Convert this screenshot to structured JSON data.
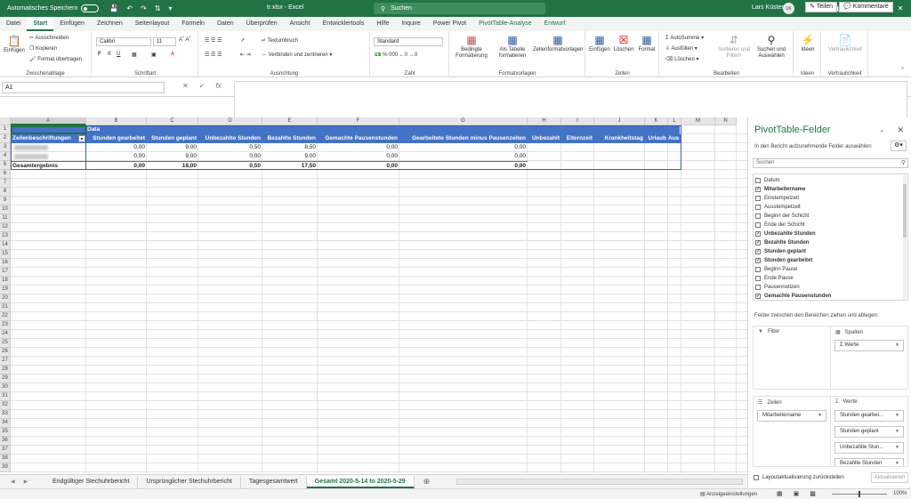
{
  "titlebar": {
    "autosave_label": "Automatisches Speichern",
    "filename": "tr.xlsx  -  Excel",
    "search_placeholder": "Suchen",
    "user_name": "Lars Küster",
    "user_initials": "LK"
  },
  "tabs": [
    "Datei",
    "Start",
    "Einfügen",
    "Zeichnen",
    "Seitenlayout",
    "Formeln",
    "Daten",
    "Überprüfen",
    "Ansicht",
    "Entwicklertools",
    "Hilfe",
    "Inquire",
    "Power Pivot",
    "PivotTable-Analyse",
    "Entwurf"
  ],
  "active_tab": "Start",
  "share_label": "Teilen",
  "comments_label": "Kommentare",
  "ribbon": {
    "clipboard": {
      "paste": "Einfügen",
      "cut": "Ausschneiden",
      "copy": "Kopieren",
      "format_painter": "Format übertragen",
      "group": "Zwischenablage"
    },
    "font": {
      "name": "Calibri",
      "size": "11",
      "group": "Schriftart"
    },
    "alignment": {
      "wrap": "Textumbruch",
      "merge": "Verbinden und zentrieren",
      "group": "Ausrichtung"
    },
    "number": {
      "format": "Standard",
      "group": "Zahl"
    },
    "styles": {
      "conditional": "Bedingte Formatierung",
      "as_table": "Als Tabelle formatieren",
      "cell_styles": "Zellenformatvorlagen",
      "group": "Formatvorlagen"
    },
    "cells": {
      "insert": "Einfügen",
      "delete": "Löschen",
      "format": "Format",
      "group": "Zellen"
    },
    "editing": {
      "autosum": "AutoSumme",
      "fill": "Ausfüllen",
      "clear": "Löschen",
      "sort": "Sortieren und Filtern",
      "find": "Suchen und Auswählen",
      "group": "Bearbeiten"
    },
    "ideas": {
      "label": "Ideen",
      "group": "Ideen"
    },
    "sensitivity": {
      "label": "Vertraulichkeit",
      "group": "Vertraulichkeit"
    }
  },
  "namebox": "A1",
  "columns": [
    "A",
    "B",
    "C",
    "D",
    "E",
    "F",
    "G",
    "H",
    "I",
    "J",
    "K",
    "L",
    "M",
    "N"
  ],
  "rows": [
    "1",
    "2",
    "3",
    "4",
    "5",
    "6",
    "7",
    "8",
    "9",
    "10",
    "11",
    "12",
    "13",
    "14",
    "15",
    "16",
    "17",
    "18",
    "19",
    "20",
    "21",
    "22",
    "23",
    "24",
    "25",
    "26",
    "27",
    "28",
    "29",
    "30",
    "31",
    "32",
    "33",
    "34",
    "35",
    "36",
    "37",
    "38",
    "39"
  ],
  "pivot": {
    "data_label": "Data",
    "row_header": "Zeilenbeschriftungen",
    "headers": [
      "Stunden gearbeitet",
      "Stunden geplant",
      "Unbezahlte Stunden",
      "Bezahlte Stunden",
      "Gemachte Pausenstunden",
      "Gearbeitete Stunden minus Pausenzeiten",
      "Unbezahlt",
      "Elternzeit",
      "Krankheitstag",
      "Urlaub",
      "Aus"
    ],
    "rows": [
      {
        "label": "",
        "values": [
          "0,00",
          "9,00",
          "0,50",
          "8,50",
          "0,00",
          "0,00"
        ]
      },
      {
        "label": "",
        "values": [
          "0,00",
          "9,00",
          "0,00",
          "9,00",
          "0,00",
          "0,00"
        ]
      }
    ],
    "total": {
      "label": "Gesamtergebnis",
      "values": [
        "0,00",
        "18,00",
        "0,50",
        "17,50",
        "0,00",
        "0,00"
      ]
    }
  },
  "sheets": [
    "Endgültiger Stechuhrbericht",
    "Ursprünglicher Stechuhrbericht",
    "Tagesgesamtwert",
    "Gesamt 2020-5-14 to 2020-5-29"
  ],
  "active_sheet": "Gesamt 2020-5-14 to 2020-5-29",
  "status": {
    "display_settings": "Anzeigeeinstellungen",
    "zoom": "100%"
  },
  "panel": {
    "title": "PivotTable-Felder",
    "subtitle": "In den Bericht aufzunehmende Felder auswählen:",
    "search_placeholder": "Suchen",
    "fields": [
      {
        "name": "Datum",
        "checked": false
      },
      {
        "name": "Mitarbeitername",
        "checked": true
      },
      {
        "name": "Einstempelzeit",
        "checked": false
      },
      {
        "name": "Ausstempelzeit",
        "checked": false
      },
      {
        "name": "Beginn der Schicht",
        "checked": false
      },
      {
        "name": "Ende der Schicht",
        "checked": false
      },
      {
        "name": "Unbezahlte Stunden",
        "checked": true
      },
      {
        "name": "Bezahlte Stunden",
        "checked": true
      },
      {
        "name": "Stunden geplant",
        "checked": true
      },
      {
        "name": "Stunden gearbeitet",
        "checked": true
      },
      {
        "name": "Beginn Pause",
        "checked": false
      },
      {
        "name": "Ende Pause",
        "checked": false
      },
      {
        "name": "Pausennotizen",
        "checked": false
      },
      {
        "name": "Gemachte Pausenstunden",
        "checked": true
      }
    ],
    "areas_label": "Felder zwischen den Bereichen ziehen und ablegen:",
    "filter_label": "Filter",
    "columns_label": "Spalten",
    "columns_items": [
      "Werte"
    ],
    "rows_label": "Zeilen",
    "rows_items": [
      "Mitarbeitername"
    ],
    "values_label": "Werte",
    "values_items": [
      "Stunden gearbei...",
      "Stunden geplant",
      "Unbezahlte Stun...",
      "Bezahlte Stunden"
    ],
    "defer_label": "Layoutaktualisierung zurückstellen",
    "update_label": "Aktualisieren"
  }
}
